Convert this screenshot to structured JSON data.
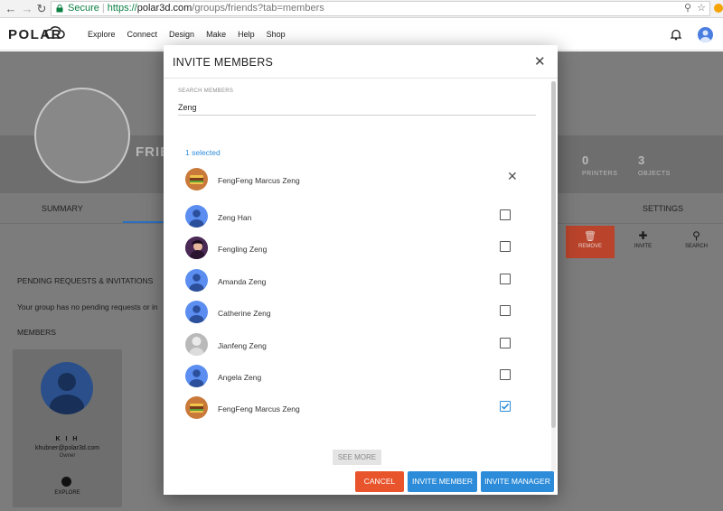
{
  "browser": {
    "secure_label": "Secure",
    "url_proto": "https://",
    "url_host": "polar3d.com",
    "url_path": "/groups/friends?tab=members"
  },
  "header": {
    "logo_text": "POLAR",
    "nav": [
      "Explore",
      "Connect",
      "Design",
      "Make",
      "Help",
      "Shop"
    ]
  },
  "group": {
    "name_partial": "FRIE",
    "stats": [
      {
        "num": "0",
        "label": "PRINTERS"
      },
      {
        "num": "3",
        "label": "OBJECTS"
      }
    ]
  },
  "tabs": {
    "summary": "SUMMARY",
    "settings": "SETTINGS"
  },
  "actions": {
    "remove": "REMOVE",
    "invite": "INVITE",
    "search": "SEARCH"
  },
  "page": {
    "pending_heading": "PENDING REQUESTS & INVITATIONS",
    "pending_text": "Your group has no pending requests or in",
    "members_heading": "MEMBERS"
  },
  "member_card": {
    "name": "K I H",
    "email": "khubner@polar3d.com",
    "role": "Owner",
    "explore": "EXPLORE"
  },
  "modal": {
    "title": "INVITE MEMBERS",
    "search_label": "SEARCH MEMBERS",
    "search_value": "Zeng",
    "selected_count": "1 selected",
    "selected_user": {
      "name": "FengFeng Marcus Zeng",
      "avatar": "burger"
    },
    "results": [
      {
        "name": "Zeng Han",
        "avatar": "default",
        "checked": false
      },
      {
        "name": "Fengling Zeng",
        "avatar": "photo",
        "checked": false
      },
      {
        "name": "Amanda Zeng",
        "avatar": "default",
        "checked": false
      },
      {
        "name": "Catherine Zeng",
        "avatar": "default",
        "checked": false
      },
      {
        "name": "Jianfeng Zeng",
        "avatar": "gray",
        "checked": false
      },
      {
        "name": "Angela Zeng",
        "avatar": "default",
        "checked": false
      },
      {
        "name": "FengFeng Marcus Zeng",
        "avatar": "burger",
        "checked": true
      }
    ],
    "see_more": "SEE MORE",
    "cancel": "CANCEL",
    "invite_member": "INVITE MEMBER",
    "invite_manager": "INVITE MANAGER"
  },
  "colors": {
    "accent_blue": "#2d8cd9",
    "cancel_orange": "#e8542c",
    "remove_red": "#b9432b"
  }
}
